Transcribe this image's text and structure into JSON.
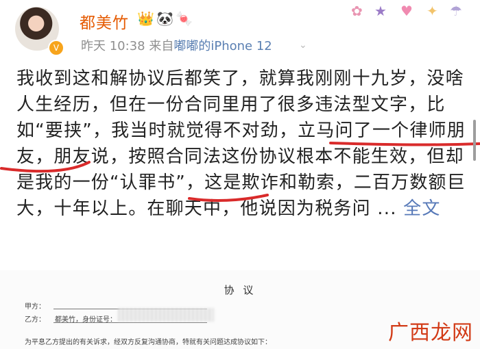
{
  "user": {
    "name": "都美竹",
    "verified_badge": "V",
    "badges": [
      "👑",
      "🐼",
      "🍬"
    ]
  },
  "post_meta": {
    "time": "昨天 10:38",
    "source_prefix": "来自",
    "device": "嘟嘟的iPhone 12",
    "expand_icon": "⌄"
  },
  "decoration": [
    "✿",
    "★",
    "♥",
    "✦",
    "☂"
  ],
  "post": {
    "text": "我收到这和解协议后都笑了，就算我刚刚十九岁，没啥人生经历，但在一份合同里用了很多违法型文字，比如“要挟”，我当时就觉得不对劲，立马问了一个律师朋友，朋友说，按照合同法这份协议根本不能生效，但却是我的一份“认罪书”，这是欺诈和勒索，二百万数额巨大，十年以上。在聊天中，他说因为税务问",
    "ellipsis": "...",
    "more_label": "全文",
    "underline_color": "#d92b2b"
  },
  "document": {
    "title": "协 议",
    "party_a_label": "甲方：",
    "party_b_label": "乙方：",
    "party_b_name": "都美竹，身份证号：",
    "body": "为平息乙方提出的有关诉求，经双方反复沟通协商，特就有关问题达成协议如下："
  },
  "watermark": "广西龙网"
}
